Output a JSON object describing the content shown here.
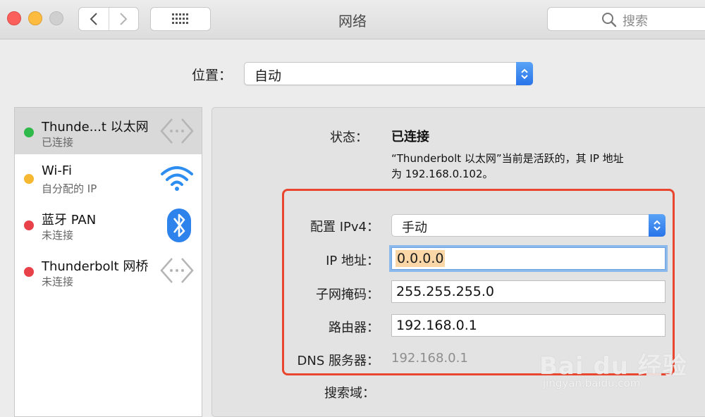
{
  "window": {
    "title": "网络",
    "search_placeholder": "搜索"
  },
  "location": {
    "label": "位置：",
    "value": "自动"
  },
  "services": [
    {
      "name": "Thunde...t 以太网",
      "status": "已连接",
      "status_color": "#2fb94a",
      "icon": "ethernet-arrows-icon",
      "selected": true
    },
    {
      "name": "Wi-Fi",
      "status": "自分配的 IP",
      "status_color": "#f5b830",
      "icon": "wifi-icon",
      "selected": false
    },
    {
      "name": "蓝牙 PAN",
      "status": "未连接",
      "status_color": "#e8414a",
      "icon": "bluetooth-icon",
      "selected": false
    },
    {
      "name": "Thunderbolt 网桥",
      "status": "未连接",
      "status_color": "#e8414a",
      "icon": "ethernet-arrows-icon",
      "selected": false
    }
  ],
  "detail": {
    "status_label": "状态：",
    "status_value": "已连接",
    "status_desc_line1": "“Thunderbolt 以太网”当前是活跃的，其 IP 地址",
    "status_desc_line2": "为 192.168.0.102。",
    "configure_ipv4_label": "配置 IPv4：",
    "configure_ipv4_value": "手动",
    "ip_label": "IP 地址：",
    "ip_value": "0.0.0.0",
    "subnet_label": "子网掩码：",
    "subnet_value": "255.255.255.0",
    "router_label": "路由器：",
    "router_value": "192.168.0.1",
    "dns_label": "DNS 服务器：",
    "dns_value": "192.168.0.1",
    "search_domain_label": "搜索域："
  },
  "watermark": {
    "brand": "Bai du 经验",
    "url": "jingyan.baidu.com"
  },
  "colors": {
    "accent": "#2874e9",
    "highlight_box": "#e8462e",
    "focus_ring": "#8bb9ec"
  }
}
